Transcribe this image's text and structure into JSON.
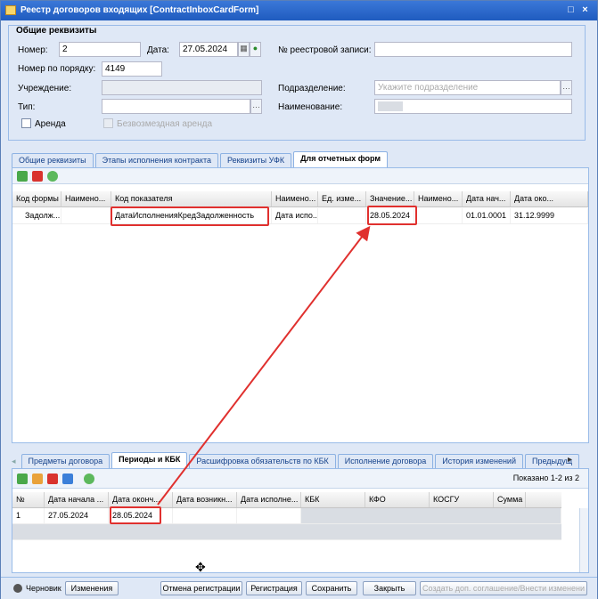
{
  "window": {
    "title": "Реестр договоров входящих [ContractInboxCardForm]"
  },
  "general": {
    "section_title": "Общие реквизиты",
    "number_label": "Номер:",
    "number_value": "2",
    "date_label": "Дата:",
    "date_value": "27.05.2024",
    "registry_no_label": "№ реестровой записи:",
    "registry_no_value": "",
    "order_no_label": "Номер по порядку:",
    "order_no_value": "4149",
    "institution_label": "Учреждение:",
    "division_label": "Подразделение:",
    "division_placeholder": "Укажите подразделение",
    "type_label": "Тип:",
    "name_label": "Наименование:",
    "lease_label": "Аренда",
    "free_lease_label": "Безвозмездная аренда"
  },
  "top_tabs": [
    "Общие реквизиты",
    "Этапы исполнения контракта",
    "Реквизиты УФК",
    "Для отчетных форм"
  ],
  "top_grid": {
    "columns": [
      "Код формы",
      "Наимено...",
      "Код показателя",
      "Наимено...",
      "Ед. изме...",
      "Значение...",
      "Наимено...",
      "Дата нач...",
      "Дата око..."
    ],
    "rows": [
      [
        "Задолж...",
        "",
        "ДатаИсполненияКредЗадолженность",
        "Дата испо...",
        "",
        "28.05.2024",
        "",
        "01.01.0001",
        "31.12.9999"
      ]
    ]
  },
  "bottom_tabs": [
    "Предметы договора",
    "Периоды и КБК",
    "Расшифровка обязательств по КБК",
    "Исполнение договора",
    "История изменений",
    "Предыдущ"
  ],
  "bottom_grid": {
    "shown": "Показано 1-2 из 2",
    "columns": [
      "№",
      "Дата начала ...",
      "Дата оконч...",
      "Дата возникн...",
      "Дата исполне...",
      "КБК",
      "КФО",
      "КОСГУ",
      "Сумма"
    ],
    "rows": [
      [
        "1",
        "27.05.2024",
        "28.05.2024",
        "",
        "",
        "",
        "",
        "",
        ""
      ]
    ]
  },
  "footer": {
    "status": "Черновик",
    "changes": "Изменения",
    "cancel_reg": "Отмена регистрации",
    "registration": "Регистрация",
    "save": "Сохранить",
    "close": "Закрыть",
    "create_extra": "Создать доп. соглашение/Внести изменени"
  },
  "colors": {
    "highlight": "#e0302e",
    "title_bar": "#2a66cc"
  }
}
